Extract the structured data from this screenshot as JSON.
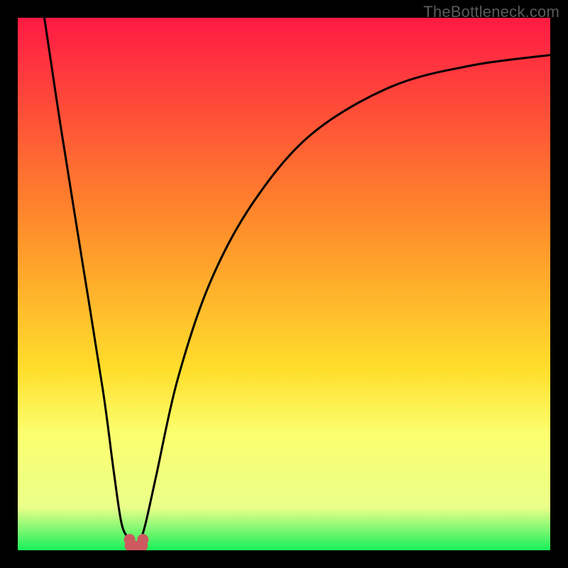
{
  "watermark": "TheBottleneck.com",
  "chart_data": {
    "type": "line",
    "title": "",
    "xlabel": "",
    "ylabel": "",
    "xlim": [
      0,
      100
    ],
    "ylim": [
      0,
      100
    ],
    "grid": false,
    "background_gradient": {
      "top": "#ff1a44",
      "mid1": "#ff8a2b",
      "mid2": "#ffde2b",
      "mid3": "#fbff6e",
      "bottom": "#18f05a"
    },
    "series": [
      {
        "name": "bottleneck-curve",
        "x": [
          5,
          8,
          12,
          16,
          18,
          19.5,
          21,
          22,
          23,
          24,
          26,
          30,
          36,
          44,
          55,
          70,
          85,
          100
        ],
        "y": [
          100,
          80,
          55,
          30,
          15,
          5,
          2,
          1,
          2,
          5,
          14,
          32,
          50,
          65,
          78,
          87,
          91,
          93
        ]
      }
    ],
    "markers": [
      {
        "name": "min-range-left",
        "x": 21.0,
        "y": 2.0,
        "color": "#cc5a5f",
        "size": 16
      },
      {
        "name": "min-range-right",
        "x": 23.5,
        "y": 2.0,
        "color": "#cc5a5f",
        "size": 16
      }
    ],
    "min_bridge": {
      "x1": 21.0,
      "x2": 23.5,
      "y": 0.8,
      "color": "#cc5a5f",
      "width": 14
    }
  }
}
